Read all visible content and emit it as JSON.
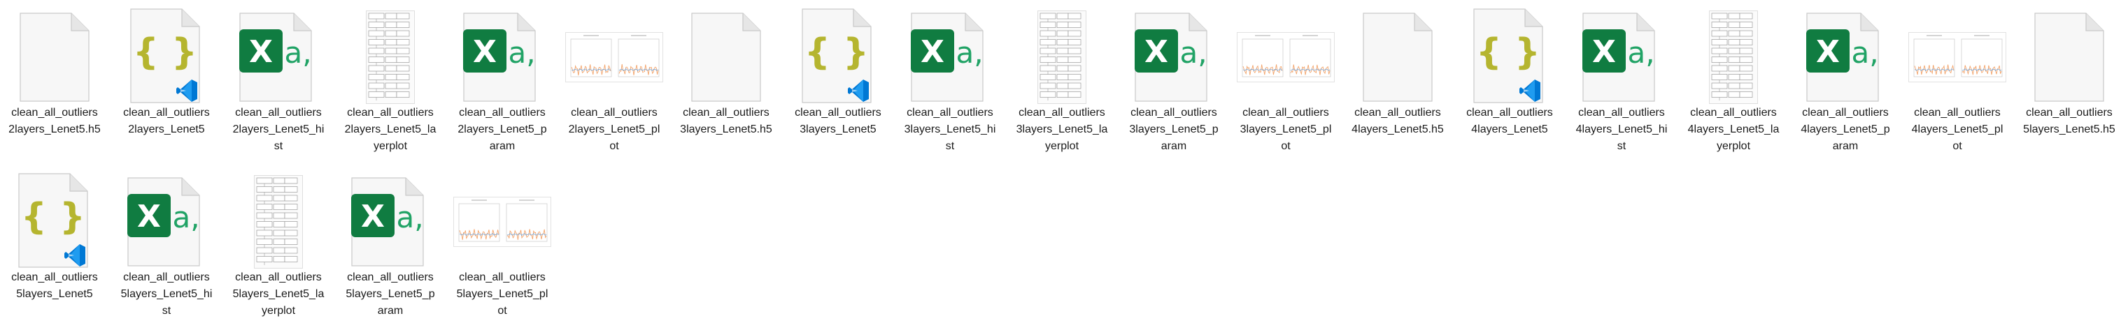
{
  "files": [
    {
      "name": "clean_all_outliers2layers_Lenet5.h5",
      "label_lines": [
        "clean_all_outliers",
        "2layers_Lenet5.h5"
      ],
      "icon": "blank-file-icon"
    },
    {
      "name": "clean_all_outliers2layers_Lenet5",
      "label_lines": [
        "clean_all_outliers",
        "2layers_Lenet5"
      ],
      "icon": "json-vscode-file-icon"
    },
    {
      "name": "clean_all_outliers2layers_Lenet5_hist",
      "label_lines": [
        "clean_all_outliers",
        "2layers_Lenet5_hi",
        "st"
      ],
      "icon": "excel-csv-file-icon"
    },
    {
      "name": "clean_all_outliers2layers_Lenet5_layerplot",
      "label_lines": [
        "clean_all_outliers",
        "2layers_Lenet5_la",
        "yerplot"
      ],
      "icon": "layerplot-thumbnail-icon"
    },
    {
      "name": "clean_all_outliers2layers_Lenet5_param",
      "label_lines": [
        "clean_all_outliers",
        "2layers_Lenet5_p",
        "aram"
      ],
      "icon": "excel-csv-file-icon"
    },
    {
      "name": "clean_all_outliers2layers_Lenet5_plot",
      "label_lines": [
        "clean_all_outliers",
        "2layers_Lenet5_pl",
        "ot"
      ],
      "icon": "training-plot-thumbnail-icon"
    },
    {
      "name": "clean_all_outliers3layers_Lenet5.h5",
      "label_lines": [
        "clean_all_outliers",
        "3layers_Lenet5.h5"
      ],
      "icon": "blank-file-icon"
    },
    {
      "name": "clean_all_outliers3layers_Lenet5",
      "label_lines": [
        "clean_all_outliers",
        "3layers_Lenet5"
      ],
      "icon": "json-vscode-file-icon"
    },
    {
      "name": "clean_all_outliers3layers_Lenet5_hist",
      "label_lines": [
        "clean_all_outliers",
        "3layers_Lenet5_hi",
        "st"
      ],
      "icon": "excel-csv-file-icon"
    },
    {
      "name": "clean_all_outliers3layers_Lenet5_layerplot",
      "label_lines": [
        "clean_all_outliers",
        "3layers_Lenet5_la",
        "yerplot"
      ],
      "icon": "layerplot-thumbnail-icon"
    },
    {
      "name": "clean_all_outliers3layers_Lenet5_param",
      "label_lines": [
        "clean_all_outliers",
        "3layers_Lenet5_p",
        "aram"
      ],
      "icon": "excel-csv-file-icon"
    },
    {
      "name": "clean_all_outliers3layers_Lenet5_plot",
      "label_lines": [
        "clean_all_outliers",
        "3layers_Lenet5_pl",
        "ot"
      ],
      "icon": "training-plot-thumbnail-icon"
    },
    {
      "name": "clean_all_outliers4layers_Lenet5.h5",
      "label_lines": [
        "clean_all_outliers",
        "4layers_Lenet5.h5"
      ],
      "icon": "blank-file-icon"
    },
    {
      "name": "clean_all_outliers4layers_Lenet5",
      "label_lines": [
        "clean_all_outliers",
        "4layers_Lenet5"
      ],
      "icon": "json-vscode-file-icon"
    },
    {
      "name": "clean_all_outliers4layers_Lenet5_hist",
      "label_lines": [
        "clean_all_outliers",
        "4layers_Lenet5_hi",
        "st"
      ],
      "icon": "excel-csv-file-icon"
    },
    {
      "name": "clean_all_outliers4layers_Lenet5_layerplot",
      "label_lines": [
        "clean_all_outliers",
        "4layers_Lenet5_la",
        "yerplot"
      ],
      "icon": "layerplot-thumbnail-icon"
    },
    {
      "name": "clean_all_outliers4layers_Lenet5_param",
      "label_lines": [
        "clean_all_outliers",
        "4layers_Lenet5_p",
        "aram"
      ],
      "icon": "excel-csv-file-icon"
    },
    {
      "name": "clean_all_outliers4layers_Lenet5_plot",
      "label_lines": [
        "clean_all_outliers",
        "4layers_Lenet5_pl",
        "ot"
      ],
      "icon": "training-plot-thumbnail-icon"
    },
    {
      "name": "clean_all_outliers5layers_Lenet5.h5",
      "label_lines": [
        "clean_all_outliers",
        "5layers_Lenet5.h5"
      ],
      "icon": "blank-file-icon"
    },
    {
      "name": "clean_all_outliers5layers_Lenet5",
      "label_lines": [
        "clean_all_outliers",
        "5layers_Lenet5"
      ],
      "icon": "json-vscode-file-icon"
    },
    {
      "name": "clean_all_outliers5layers_Lenet5_hist",
      "label_lines": [
        "clean_all_outliers",
        "5layers_Lenet5_hi",
        "st"
      ],
      "icon": "excel-csv-file-icon"
    },
    {
      "name": "clean_all_outliers5layers_Lenet5_layerplot",
      "label_lines": [
        "clean_all_outliers",
        "5layers_Lenet5_la",
        "yerplot"
      ],
      "icon": "layerplot-thumbnail-icon"
    },
    {
      "name": "clean_all_outliers5layers_Lenet5_param",
      "label_lines": [
        "clean_all_outliers",
        "5layers_Lenet5_p",
        "aram"
      ],
      "icon": "excel-csv-file-icon"
    },
    {
      "name": "clean_all_outliers5layers_Lenet5_plot",
      "label_lines": [
        "clean_all_outliers",
        "5layers_Lenet5_pl",
        "ot"
      ],
      "icon": "training-plot-thumbnail-icon"
    }
  ],
  "colors": {
    "excel_green": "#107c41",
    "excel_accent": "#21a366",
    "json_braces": "#b5b52f",
    "vscode_blue": "#0078d4",
    "plot_orange": "#f3a46b",
    "plot_blue": "#6aa0d8"
  }
}
